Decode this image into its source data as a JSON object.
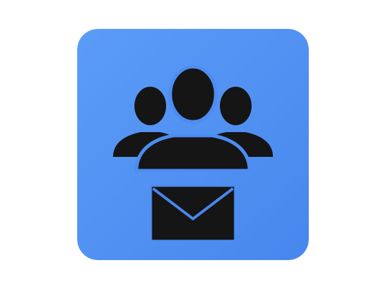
{
  "icon": {
    "name": "group-mail-app-icon",
    "colors": {
      "tile_light": "#5b9cf7",
      "tile_dark": "#4787ee",
      "glyph": "#151515",
      "outline": "#4d8cf2"
    },
    "glyphs": [
      "group-of-people-icon",
      "envelope-icon"
    ]
  }
}
